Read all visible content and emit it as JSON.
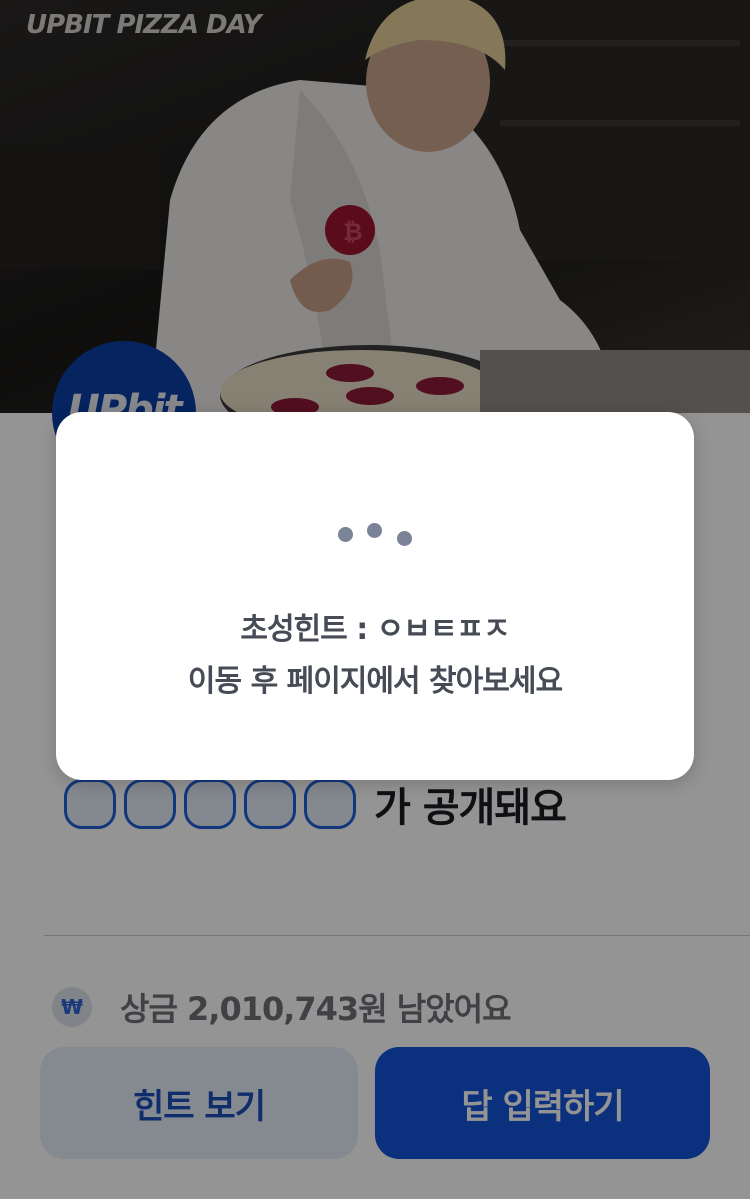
{
  "hero": {
    "brand": "UPBIT PIZZA DAY",
    "logo_text": "UPbit"
  },
  "answer": {
    "slot_count": 5,
    "reveal_text": "가 공개돼요"
  },
  "prize": {
    "icon": "won-icon",
    "icon_glyph": "₩",
    "text": "상금 2,010,743원 남았어요"
  },
  "buttons": {
    "hint_label": "힌트 보기",
    "answer_label": "답 입력하기"
  },
  "modal": {
    "loading_icon": "loading-dots-icon",
    "hint_line_1": "초성힌트 : ㅇㅂㅌㅍㅈ",
    "hint_line_2": "이동 후 페이지에서 찾아보세요"
  },
  "colors": {
    "accent": "#1454d8",
    "hint_button_bg": "#e6edf9",
    "logo_blue": "#0a3fa6",
    "loading_dot": "#7a8397"
  }
}
